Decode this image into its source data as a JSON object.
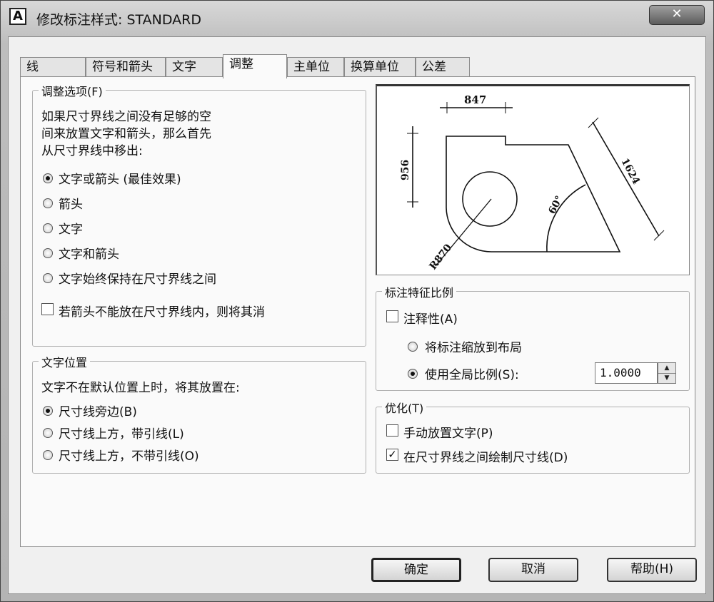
{
  "window": {
    "title": "修改标注样式: STANDARD",
    "close_label": "✕",
    "icon_letter": "A"
  },
  "tabs": [
    {
      "label": "线",
      "active": false
    },
    {
      "label": "符号和箭头",
      "active": false
    },
    {
      "label": "文字",
      "active": false
    },
    {
      "label": "调整",
      "active": true
    },
    {
      "label": "主单位",
      "active": false
    },
    {
      "label": "换算单位",
      "active": false
    },
    {
      "label": "公差",
      "active": false
    }
  ],
  "fit_options": {
    "title": "调整选项(F)",
    "description": [
      "如果尺寸界线之间没有足够的空",
      "间来放置文字和箭头，那么首先",
      "从尺寸界线中移出:"
    ],
    "radios": [
      {
        "label": "文字或箭头 (最佳效果)",
        "selected": true
      },
      {
        "label": "箭头",
        "selected": false
      },
      {
        "label": "文字",
        "selected": false
      },
      {
        "label": "文字和箭头",
        "selected": false
      },
      {
        "label": "文字始终保持在尺寸界线之间",
        "selected": false
      }
    ],
    "checkbox": {
      "label": "若箭头不能放在尺寸界线内，则将其消",
      "checked": false
    }
  },
  "text_placement": {
    "title": "文字位置",
    "description": "文字不在默认位置上时，将其放置在:",
    "radios": [
      {
        "label": "尺寸线旁边(B)",
        "selected": true
      },
      {
        "label": "尺寸线上方，带引线(L)",
        "selected": false
      },
      {
        "label": "尺寸线上方，不带引线(O)",
        "selected": false
      }
    ]
  },
  "preview": {
    "dims": [
      "847",
      "956",
      "1624",
      "60°",
      "R870"
    ]
  },
  "scale": {
    "title": "标注特征比例",
    "annotative": {
      "label": "注释性(A)",
      "checked": false
    },
    "radios": [
      {
        "label": "将标注缩放到布局",
        "selected": false
      },
      {
        "label": "使用全局比例(S):",
        "selected": true
      }
    ],
    "value": "1.0000"
  },
  "finetune": {
    "title": "优化(T)",
    "checks": [
      {
        "label": "手动放置文字(P)",
        "checked": false
      },
      {
        "label": "在尺寸界线之间绘制尺寸线(D)",
        "checked": true
      }
    ]
  },
  "buttons": {
    "ok": "确定",
    "cancel": "取消",
    "help": "帮助(H)"
  }
}
